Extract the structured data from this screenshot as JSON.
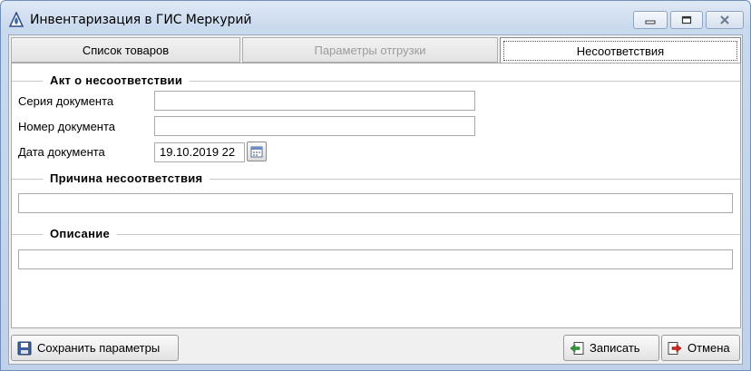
{
  "window": {
    "title": "Инвентаризация в ГИС Меркурий"
  },
  "tabs": [
    {
      "label": "Список товаров"
    },
    {
      "label": "Параметры отгрузки"
    },
    {
      "label": "Несоответствия"
    }
  ],
  "act_section": {
    "title": "Акт о несоответствии",
    "series_label": "Серия документа",
    "series_value": "",
    "number_label": "Номер документа",
    "number_value": "",
    "date_label": "Дата документа",
    "date_value": "19.10.2019 22"
  },
  "reason_section": {
    "title": "Причина несоответствия",
    "value": ""
  },
  "description_section": {
    "title": "Описание",
    "value": ""
  },
  "buttons": {
    "save_params": "Сохранить параметры",
    "write": "Записать",
    "cancel": "Отмена"
  },
  "icons": {
    "app": "mercury-app-icon",
    "calendar": "calendar-icon",
    "save": "floppy-disk-icon",
    "write": "write-arrow-icon",
    "cancel": "cancel-exit-icon"
  }
}
